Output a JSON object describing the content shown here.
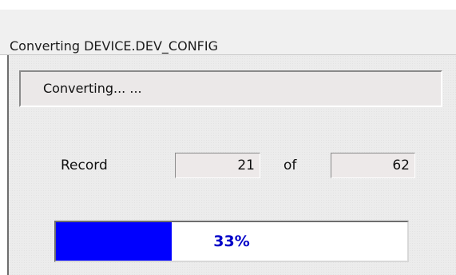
{
  "window": {
    "title": "Converting DEVICE.DEV_CONFIG"
  },
  "status": {
    "message": "Converting... ..."
  },
  "record": {
    "label": "Record",
    "current": "21",
    "of_label": "of",
    "total": "62"
  },
  "progress": {
    "percent": 33,
    "text": "33%",
    "fill_color": "#0000ff",
    "text_color": "#0000c8"
  }
}
